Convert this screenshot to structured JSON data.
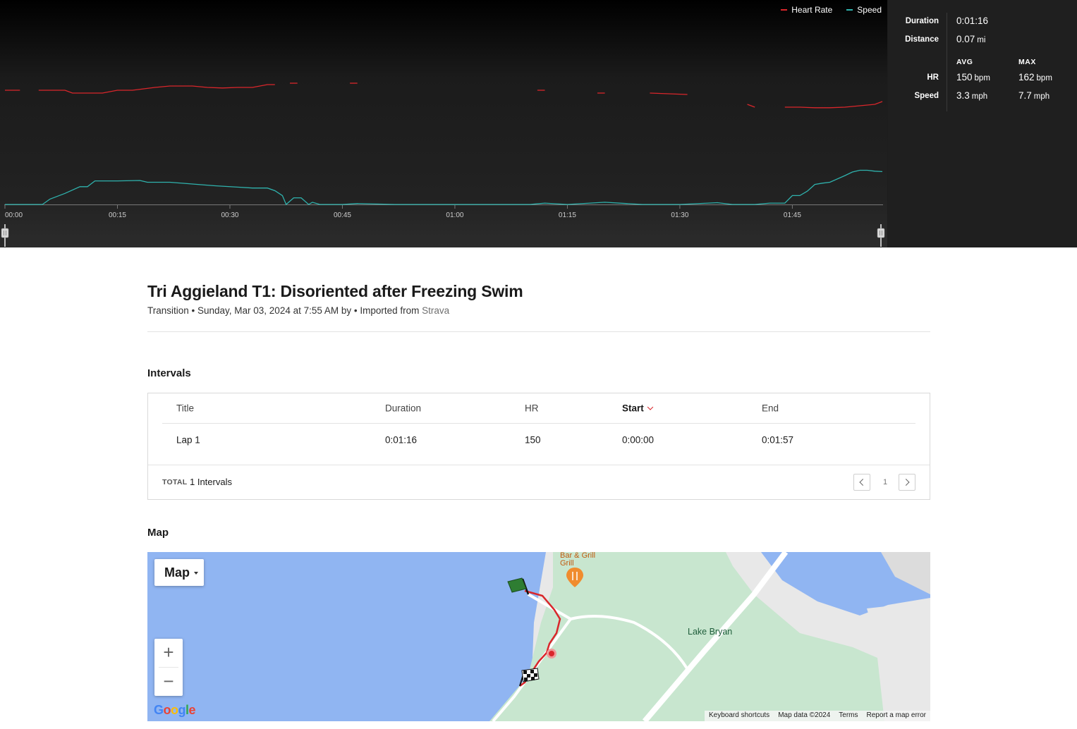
{
  "chart": {
    "legend": [
      {
        "label": "Heart Rate",
        "color": "#d9262b"
      },
      {
        "label": "Speed",
        "color": "#2fb2ad"
      }
    ],
    "x_ticks": [
      "00:00",
      "00:15",
      "00:30",
      "00:45",
      "01:00",
      "01:15",
      "01:30",
      "01:45"
    ]
  },
  "stats": {
    "duration_label": "Duration",
    "duration_value": "0:01:16",
    "distance_label": "Distance",
    "distance_value": "0.07",
    "distance_unit": "mi",
    "avg_head": "AVG",
    "max_head": "MAX",
    "hr_label": "HR",
    "hr_avg": "150",
    "hr_max": "162",
    "hr_unit": "bpm",
    "speed_label": "Speed",
    "speed_avg": "3.3",
    "speed_max": "7.7",
    "speed_unit": "mph"
  },
  "activity": {
    "title": "Tri Aggieland T1: Disoriented after Freezing Swim",
    "subtitle": "Transition • Sunday, Mar 03, 2024 at 7:55 AM by • Imported from",
    "source": "Strava"
  },
  "intervals": {
    "section_title": "Intervals",
    "columns": [
      "Title",
      "Duration",
      "HR",
      "Start",
      "End"
    ],
    "rows": [
      {
        "title": "Lap 1",
        "duration": "0:01:16",
        "hr": "150",
        "start": "0:00:00",
        "end": "0:01:57"
      }
    ],
    "total_label": "TOTAL",
    "total_value": "1 Intervals",
    "page": "1"
  },
  "map": {
    "section_title": "Map",
    "type_button": "Map",
    "zoom_in": "+",
    "zoom_out": "−",
    "place_label": "Lake Bryan",
    "poi_label_1": "Bar & Grill",
    "poi_label_2": "Grill",
    "logo": "Google",
    "footer": [
      "Keyboard shortcuts",
      "Map data ©2024",
      "Terms",
      "Report a map error"
    ]
  },
  "chart_data": {
    "type": "line",
    "x_unit": "mm:ss",
    "x_range": [
      0,
      117
    ],
    "series": [
      {
        "name": "Heart Rate",
        "color": "#d9262b",
        "points": [
          [
            0,
            151
          ],
          [
            2,
            151
          ],
          [
            2.5,
            null
          ],
          [
            4.5,
            151
          ],
          [
            8,
            151
          ],
          [
            9,
            150
          ],
          [
            10,
            150
          ],
          [
            12,
            150
          ],
          [
            13,
            150
          ],
          [
            15,
            151
          ],
          [
            17,
            151
          ],
          [
            20,
            152
          ],
          [
            22,
            152.5
          ],
          [
            25,
            152.5
          ],
          [
            27,
            152
          ],
          [
            29,
            151.8
          ],
          [
            31,
            152
          ],
          [
            33,
            152
          ],
          [
            34,
            152.5
          ],
          [
            35,
            153
          ],
          [
            36,
            153
          ],
          [
            36.5,
            null
          ],
          [
            38,
            153.5
          ],
          [
            39,
            153.5
          ],
          [
            39.5,
            null
          ],
          [
            46,
            153.5
          ],
          [
            47,
            153.5
          ],
          [
            47.5,
            null
          ],
          [
            71,
            151
          ],
          [
            72,
            151
          ],
          [
            72.5,
            null
          ],
          [
            79,
            150
          ],
          [
            80,
            150
          ],
          [
            80.5,
            null
          ],
          [
            86,
            150
          ],
          [
            91,
            149.5
          ],
          [
            91.5,
            null
          ],
          [
            99,
            146
          ],
          [
            100,
            145
          ],
          [
            100.5,
            null
          ],
          [
            104,
            145
          ],
          [
            106,
            145
          ],
          [
            108,
            144.8
          ],
          [
            110,
            144.8
          ],
          [
            112,
            145
          ],
          [
            114,
            145.5
          ],
          [
            116,
            146
          ],
          [
            117,
            147
          ]
        ]
      },
      {
        "name": "Speed",
        "color": "#2fb2ad",
        "points": [
          [
            0,
            0
          ],
          [
            5,
            0
          ],
          [
            6,
            1.2
          ],
          [
            8,
            2.5
          ],
          [
            10,
            4
          ],
          [
            11,
            4
          ],
          [
            12,
            5.3
          ],
          [
            15,
            5.3
          ],
          [
            18,
            5.4
          ],
          [
            19,
            5
          ],
          [
            22,
            5
          ],
          [
            25,
            4.6
          ],
          [
            28,
            4.2
          ],
          [
            31,
            3.9
          ],
          [
            33,
            3.7
          ],
          [
            35,
            3.7
          ],
          [
            36,
            3.1
          ],
          [
            37,
            2
          ],
          [
            37.5,
            0
          ],
          [
            38.5,
            1.5
          ],
          [
            39.5,
            1.5
          ],
          [
            40.5,
            0
          ],
          [
            41,
            0.5
          ],
          [
            42,
            0
          ],
          [
            45,
            0
          ],
          [
            47,
            0.2
          ],
          [
            52,
            0
          ],
          [
            56,
            0
          ],
          [
            60,
            0
          ],
          [
            66,
            0
          ],
          [
            70,
            0
          ],
          [
            72,
            0.3
          ],
          [
            75,
            0
          ],
          [
            80,
            0.5
          ],
          [
            85,
            0
          ],
          [
            90,
            0
          ],
          [
            95,
            0.4
          ],
          [
            97,
            0
          ],
          [
            100,
            0
          ],
          [
            102,
            0.3
          ],
          [
            104,
            0.3
          ],
          [
            105,
            2
          ],
          [
            106,
            2
          ],
          [
            107,
            3
          ],
          [
            108,
            4.5
          ],
          [
            109,
            4.8
          ],
          [
            110,
            5
          ],
          [
            112,
            6.5
          ],
          [
            113,
            7.3
          ],
          [
            114,
            7.7
          ],
          [
            115,
            7.7
          ],
          [
            116,
            7.5
          ],
          [
            117,
            7.4
          ]
        ]
      }
    ]
  }
}
